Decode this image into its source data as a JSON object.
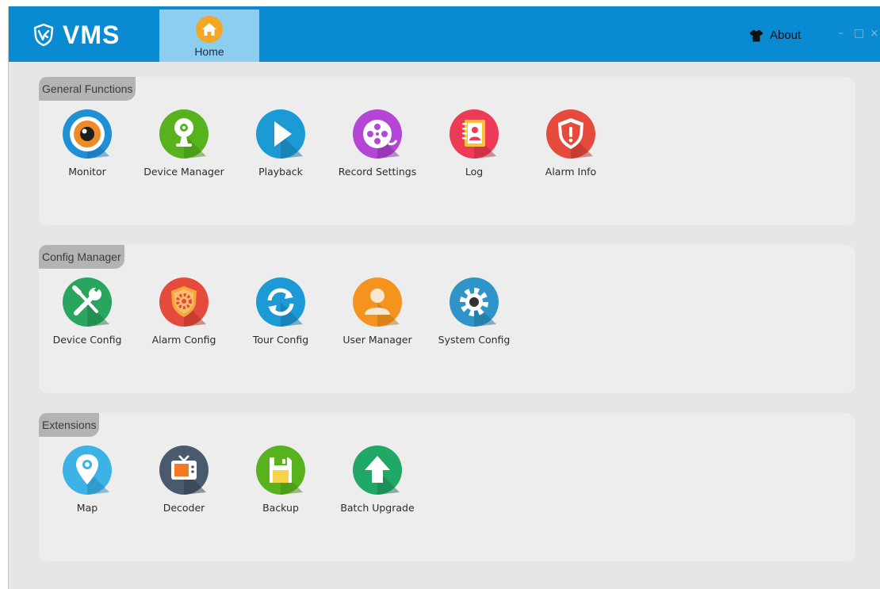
{
  "app": {
    "title": "VMS"
  },
  "tabs": [
    {
      "label": "Home"
    }
  ],
  "header": {
    "about_label": "About"
  },
  "window_controls": {
    "minimize": "–",
    "maximize": "□",
    "close": "×"
  },
  "sections": [
    {
      "title": "General Functions",
      "items": [
        {
          "label": "Monitor",
          "icon": "monitor-icon"
        },
        {
          "label": "Device Manager",
          "icon": "webcam-icon"
        },
        {
          "label": "Playback",
          "icon": "play-icon"
        },
        {
          "label": "Record Settings",
          "icon": "film-reel-icon"
        },
        {
          "label": "Log",
          "icon": "notebook-icon"
        },
        {
          "label": "Alarm Info",
          "icon": "shield-alert-icon"
        }
      ]
    },
    {
      "title": "Config Manager",
      "items": [
        {
          "label": "Device Config",
          "icon": "tools-icon"
        },
        {
          "label": "Alarm Config",
          "icon": "shield-gear-icon"
        },
        {
          "label": "Tour Config",
          "icon": "refresh-icon"
        },
        {
          "label": "User Manager",
          "icon": "user-icon"
        },
        {
          "label": "System Config",
          "icon": "gear-icon"
        }
      ]
    },
    {
      "title": "Extensions",
      "items": [
        {
          "label": "Map",
          "icon": "map-pin-icon"
        },
        {
          "label": "Decoder",
          "icon": "tv-icon"
        },
        {
          "label": "Backup",
          "icon": "floppy-disk-icon"
        },
        {
          "label": "Batch Upgrade",
          "icon": "upload-arrow-icon"
        }
      ]
    }
  ],
  "colors": {
    "titlebar": "#0a8ad0",
    "active_tab": "#8dcdf0",
    "panel": "#ededed",
    "panel_title": "#b3b3b3",
    "background": "#e6e6e8"
  }
}
